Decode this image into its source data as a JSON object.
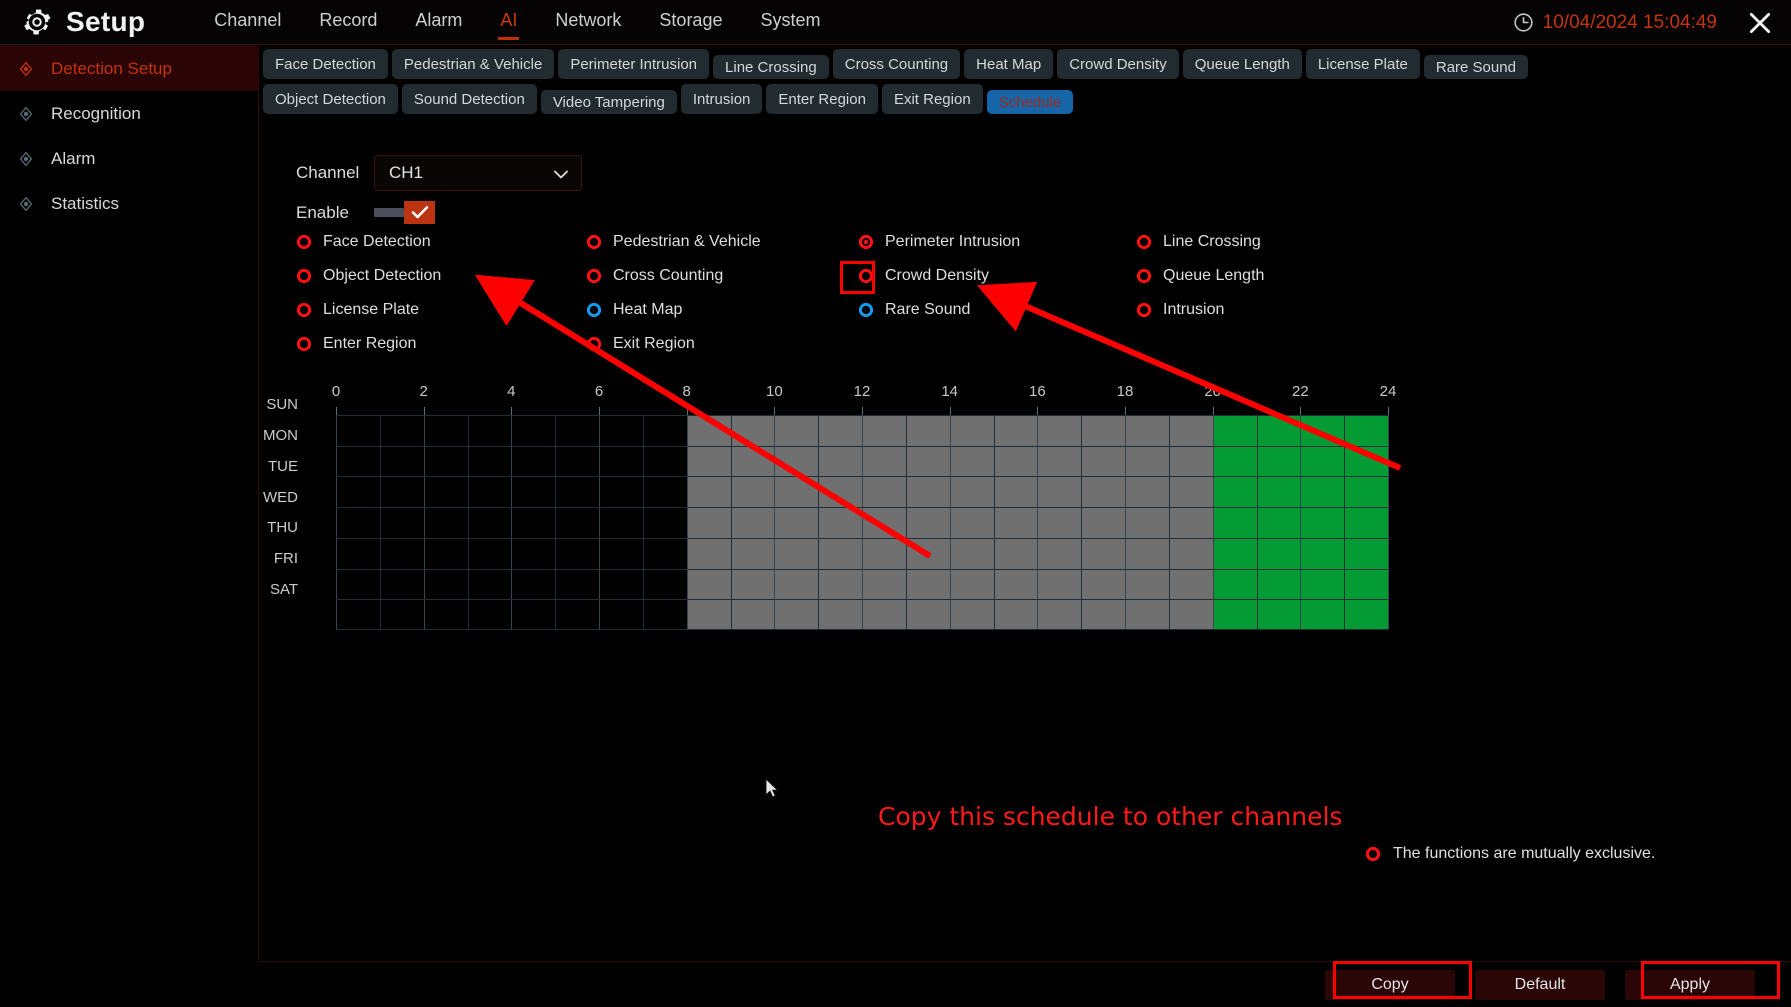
{
  "topbar": {
    "app_title": "Setup",
    "gear_icon": "gear-icon",
    "clock_icon": "clock-icon",
    "datetime": "10/04/2024 15:04:49",
    "close_icon": "close-icon",
    "menu": [
      {
        "label": "Channel",
        "active": false
      },
      {
        "label": "Record",
        "active": false
      },
      {
        "label": "Alarm",
        "active": false
      },
      {
        "label": "AI",
        "active": true
      },
      {
        "label": "Network",
        "active": false
      },
      {
        "label": "Storage",
        "active": false
      },
      {
        "label": "System",
        "active": false
      }
    ]
  },
  "sidebar": {
    "items": [
      {
        "label": "Detection Setup",
        "icon": "target-dot-icon",
        "active": true
      },
      {
        "label": "Recognition",
        "icon": "target-dot-icon",
        "active": false
      },
      {
        "label": "Alarm",
        "icon": "target-dot-icon",
        "active": false
      },
      {
        "label": "Statistics",
        "icon": "target-dot-icon",
        "active": false
      }
    ]
  },
  "tabs": {
    "row1": [
      {
        "label": "Face Detection",
        "size": "tall",
        "selected": false
      },
      {
        "label": "Pedestrian & Vehicle",
        "size": "tall",
        "selected": false
      },
      {
        "label": "Perimeter Intrusion",
        "size": "tall",
        "selected": false
      },
      {
        "label": "Line Crossing",
        "size": "short",
        "selected": false
      },
      {
        "label": "Cross Counting",
        "size": "tall",
        "selected": false
      },
      {
        "label": "Heat Map",
        "size": "tall",
        "selected": false
      },
      {
        "label": "Crowd Density",
        "size": "tall",
        "selected": false
      },
      {
        "label": "Queue Length",
        "size": "tall",
        "selected": false
      },
      {
        "label": "License Plate",
        "size": "tall",
        "selected": false
      },
      {
        "label": "Rare Sound",
        "size": "short",
        "selected": false
      }
    ],
    "row2": [
      {
        "label": "Object Detection",
        "size": "tall",
        "selected": false
      },
      {
        "label": "Sound Detection",
        "size": "tall",
        "selected": false
      },
      {
        "label": "Video Tampering",
        "size": "short",
        "selected": false
      },
      {
        "label": "Intrusion",
        "size": "tall",
        "selected": false
      },
      {
        "label": "Enter Region",
        "size": "tall",
        "selected": false
      },
      {
        "label": "Exit Region",
        "size": "tall",
        "selected": false
      },
      {
        "label": "Schedule",
        "size": "short",
        "selected": true
      }
    ]
  },
  "form": {
    "channel_label": "Channel",
    "channel_value": "CH1",
    "chevron_icon": "chevron-down-icon",
    "enable_label": "Enable",
    "enable_checked": true,
    "check_icon": "check-icon"
  },
  "options": [
    {
      "label": "Face Detection",
      "col": 0,
      "row": 0,
      "color": "#ff1111",
      "selected": false
    },
    {
      "label": "Object Detection",
      "col": 0,
      "row": 1,
      "color": "#ff1111",
      "selected": false
    },
    {
      "label": "License Plate",
      "col": 0,
      "row": 2,
      "color": "#ff1111",
      "selected": false
    },
    {
      "label": "Enter Region",
      "col": 0,
      "row": 3,
      "color": "#ff1111",
      "selected": false
    },
    {
      "label": "Pedestrian & Vehicle",
      "col": 1,
      "row": 0,
      "color": "#ff1111",
      "selected": false
    },
    {
      "label": "Cross Counting",
      "col": 1,
      "row": 1,
      "color": "#ff1111",
      "selected": false
    },
    {
      "label": "Heat Map",
      "col": 1,
      "row": 2,
      "color": "#1199ee",
      "selected": false
    },
    {
      "label": "Exit Region",
      "col": 1,
      "row": 3,
      "color": "#ff1111",
      "selected": false
    },
    {
      "label": "Perimeter Intrusion",
      "col": 2,
      "row": 0,
      "color": "#ff1111",
      "selected": true
    },
    {
      "label": "Crowd Density",
      "col": 2,
      "row": 1,
      "color": "#ff1111",
      "selected": false
    },
    {
      "label": "Rare Sound",
      "col": 2,
      "row": 2,
      "color": "#1199ee",
      "selected": false
    },
    {
      "label": "Line Crossing",
      "col": 3,
      "row": 0,
      "color": "#ff1111",
      "selected": false
    },
    {
      "label": "Queue Length",
      "col": 3,
      "row": 1,
      "color": "#ff1111",
      "selected": false
    },
    {
      "label": "Intrusion",
      "col": 3,
      "row": 2,
      "color": "#ff1111",
      "selected": false
    }
  ],
  "chart_data": {
    "type": "heatmap",
    "title": "",
    "xlabel": "",
    "ylabel": "",
    "xlim": [
      0,
      24
    ],
    "grid": true,
    "hour_ticks": [
      0,
      2,
      4,
      6,
      8,
      10,
      12,
      14,
      16,
      18,
      20,
      22,
      24
    ],
    "days": [
      "SUN",
      "MON",
      "TUE",
      "WED",
      "THU",
      "FRI",
      "SAT"
    ],
    "colors": {
      "off": "#000000",
      "gray": "#707070",
      "green": "#049b34"
    },
    "legend": [
      {
        "state": "green",
        "hours": [
          20,
          24
        ]
      },
      {
        "state": "gray",
        "hours": [
          8,
          20
        ]
      },
      {
        "state": "off",
        "hours": [
          0,
          8
        ]
      }
    ],
    "series": [
      {
        "name": "SUN",
        "segments": [
          {
            "from": 0,
            "to": 8,
            "state": "off"
          },
          {
            "from": 8,
            "to": 20,
            "state": "gray"
          },
          {
            "from": 20,
            "to": 24,
            "state": "green"
          }
        ]
      },
      {
        "name": "MON",
        "segments": [
          {
            "from": 0,
            "to": 8,
            "state": "off"
          },
          {
            "from": 8,
            "to": 20,
            "state": "gray"
          },
          {
            "from": 20,
            "to": 24,
            "state": "green"
          }
        ]
      },
      {
        "name": "TUE",
        "segments": [
          {
            "from": 0,
            "to": 8,
            "state": "off"
          },
          {
            "from": 8,
            "to": 20,
            "state": "gray"
          },
          {
            "from": 20,
            "to": 24,
            "state": "green"
          }
        ]
      },
      {
        "name": "WED",
        "segments": [
          {
            "from": 0,
            "to": 8,
            "state": "off"
          },
          {
            "from": 8,
            "to": 20,
            "state": "gray"
          },
          {
            "from": 20,
            "to": 24,
            "state": "green"
          }
        ]
      },
      {
        "name": "THU",
        "segments": [
          {
            "from": 0,
            "to": 8,
            "state": "off"
          },
          {
            "from": 8,
            "to": 20,
            "state": "gray"
          },
          {
            "from": 20,
            "to": 24,
            "state": "green"
          }
        ]
      },
      {
        "name": "FRI",
        "segments": [
          {
            "from": 0,
            "to": 8,
            "state": "off"
          },
          {
            "from": 8,
            "to": 20,
            "state": "gray"
          },
          {
            "from": 20,
            "to": 24,
            "state": "green"
          }
        ]
      },
      {
        "name": "SAT",
        "segments": [
          {
            "from": 0,
            "to": 8,
            "state": "off"
          },
          {
            "from": 8,
            "to": 20,
            "state": "gray"
          },
          {
            "from": 20,
            "to": 24,
            "state": "green"
          }
        ]
      }
    ]
  },
  "legend": {
    "icon": "red-circle-icon",
    "text": "The functions are mutually exclusive."
  },
  "annotation": {
    "note": "Copy this schedule to other channels",
    "color": "#ff1a1a"
  },
  "buttons": {
    "copy": "Copy",
    "default": "Default",
    "apply": "Apply"
  }
}
